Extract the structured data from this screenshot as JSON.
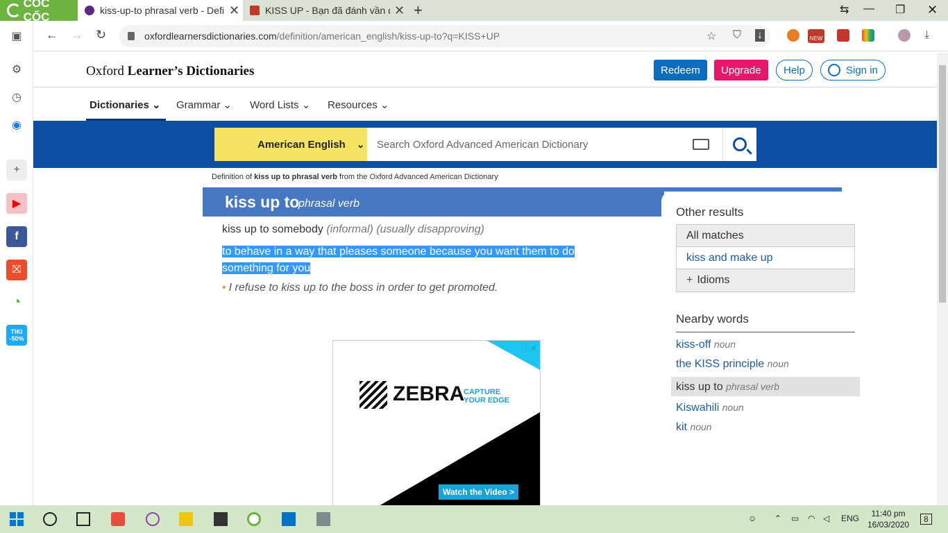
{
  "browser": {
    "brand": "CỐC CỐC",
    "tabs": [
      {
        "title": "kiss-up-to phrasal verb - Defi",
        "active": true
      },
      {
        "title": "KISS UP - Bạn đã đánh vần đú",
        "active": false
      }
    ],
    "url_host": "oxfordlearnersdictionaries.com",
    "url_path": "/definition/american_english/kiss-up-to?q=KISS+UP",
    "ext_badge": "NEW"
  },
  "sidebar": {
    "icons": [
      "panel-icon",
      "settings-icon",
      "history-icon",
      "messenger-icon",
      "add-icon",
      "youtube-icon",
      "facebook-icon",
      "shopee-icon",
      "coccoc-icon",
      "tiki-icon"
    ],
    "tiki_label": "TIKI\n-50%"
  },
  "site": {
    "logo_light": "Oxford",
    "logo_bold": "Learner’s Dictionaries",
    "buttons": {
      "redeem": "Redeem",
      "upgrade": "Upgrade",
      "help": "Help",
      "signin": "Sign in"
    },
    "menu": [
      "Dictionaries",
      "Grammar",
      "Word Lists",
      "Resources"
    ],
    "dict_select": "American English",
    "search_placeholder": "Search Oxford Advanced American Dictionary",
    "crumb_pre": "Definition of ",
    "crumb_bold": "kiss up to phrasal verb",
    "crumb_post": " from the Oxford Advanced American Dictionary"
  },
  "entry": {
    "headword": "kiss up to",
    "pos": "phrasal verb",
    "sense_head": "kiss up to somebody",
    "label1": "informal",
    "label2": "usually disapproving",
    "definition": "to behave in a way that pleases someone because you want them to do something for you",
    "example": "I refuse to kiss up to the boss in order to get promoted."
  },
  "ad": {
    "brand": "ZEBRA",
    "tagline_1": "CAPTURE",
    "tagline_2": "YOUR EDGE",
    "cta": "Watch the Video >"
  },
  "other_results": {
    "title": "Other results",
    "all_matches": "All matches",
    "link": "kiss and make up",
    "idioms": "Idioms"
  },
  "nearby": {
    "title": "Nearby words",
    "items": [
      {
        "word": "kiss-off",
        "pos": "noun"
      },
      {
        "word": "the KISS principle",
        "pos": "noun"
      },
      {
        "word": "kiss up to",
        "pos": "phrasal verb"
      },
      {
        "word": "Kiswahili",
        "pos": "noun"
      },
      {
        "word": "kit",
        "pos": "noun"
      }
    ]
  },
  "taskbar": {
    "lang": "ENG",
    "time": "11:40 pm",
    "date": "16/03/2020",
    "notif_count": "8"
  },
  "colors": {
    "oxford_blue": "#0b4ea2",
    "headbar": "#4678c2",
    "redeem": "#0c6dc0",
    "upgrade": "#e8166a",
    "dict_yellow": "#f5e461",
    "coccoc_green": "#6db33f"
  }
}
